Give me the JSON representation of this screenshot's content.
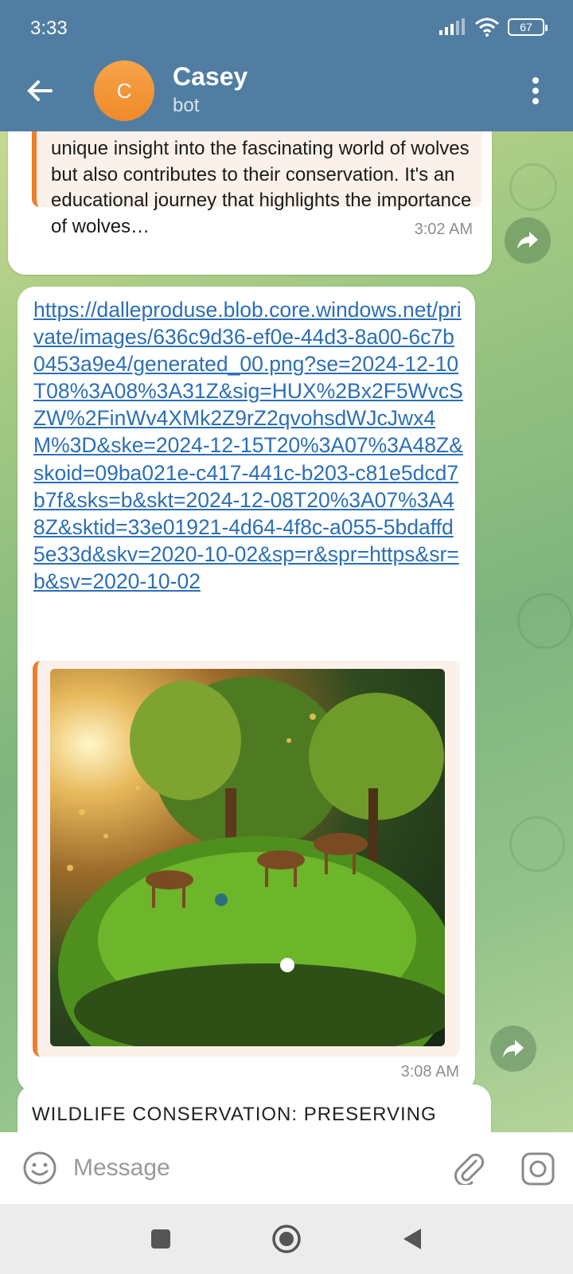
{
  "status_bar": {
    "time": "3:33",
    "battery": "67"
  },
  "header": {
    "avatar_letter": "C",
    "name": "Casey",
    "subtitle": "bot"
  },
  "messages": [
    {
      "quote_text": "unique insight into the fascinating world of wolves but also contributes to their conservation. It's an educational journey that highlights the importance of wolves…",
      "time": "3:02 AM"
    },
    {
      "link": "https://dalleproduse.blob.core.windows.net/private/images/636c9d36-ef0e-44d3-8a00-6c7b0453a9e4/generated_00.png?se=2024-12-10T08%3A08%3A31Z&sig=HUX%2Bx2F5WvcSZW%2FinWv4XMk2Z9rZ2qvohsdWJcJwx4M%3D&ske=2024-12-15T20%3A07%3A48Z&skoid=09ba021e-c417-441c-b203-c81e5dcd7b7f&sks=b&skt=2024-12-08T20%3A07%3A48Z&sktid=33e01921-4d64-4f8c-a055-5bdaffd5e33d&skv=2020-10-02&sp=r&spr=https&sr=b&sv=2020-10-02",
      "time": "3:08 AM"
    },
    {
      "text": "WILDLIFE CONSERVATION: PRESERVING"
    }
  ],
  "input": {
    "placeholder": "Message"
  },
  "colors": {
    "header": "#517da2",
    "accent": "#e8802c",
    "link": "#2b6fb6",
    "avatar": "#f29433"
  }
}
